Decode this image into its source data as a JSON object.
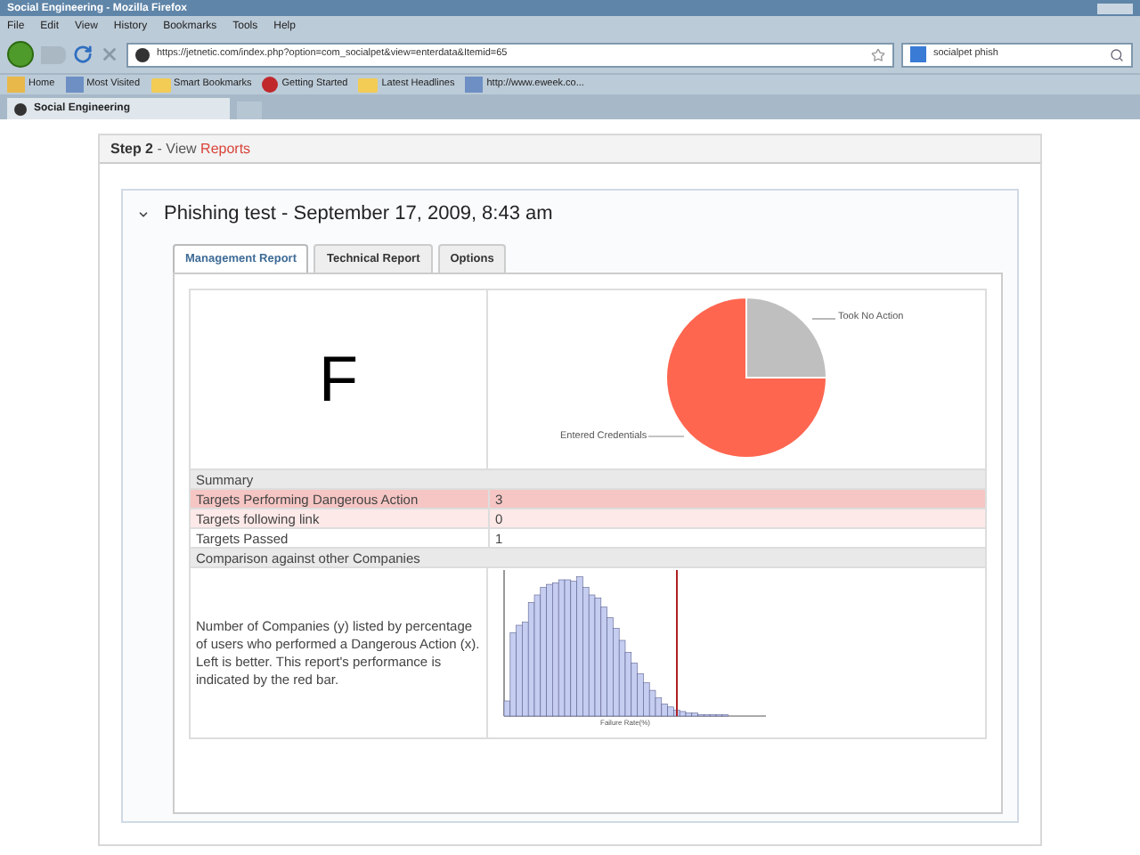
{
  "window": {
    "title": "Social Engineering - Mozilla Firefox"
  },
  "menu": [
    "File",
    "Edit",
    "View",
    "History",
    "Bookmarks",
    "Tools",
    "Help"
  ],
  "address": {
    "value": "https://jetnetic.com/index.php?option=com_socialpet&view=enterdata&Itemid=65"
  },
  "search": {
    "value": "socialpet phish"
  },
  "bookmarks": [
    {
      "label": "Home",
      "kind": "home"
    },
    {
      "label": "Most Visited",
      "kind": "page"
    },
    {
      "label": "Smart Bookmarks",
      "kind": "folder"
    },
    {
      "label": "Getting Started",
      "kind": "start"
    },
    {
      "label": "Latest Headlines",
      "kind": "folder"
    },
    {
      "label": "http://www.eweek.co...",
      "kind": "page"
    }
  ],
  "browser_tabs": [
    {
      "label": "Social Engineering",
      "selected": true
    }
  ],
  "step": {
    "label": "Step 2",
    "separator": " - View ",
    "highlight": "Reports"
  },
  "report": {
    "title": "Phishing test - September 17, 2009, 8:43 am",
    "expanded": true,
    "tabs": [
      {
        "label": "Management Report",
        "selected": true
      },
      {
        "label": "Technical Report",
        "selected": false
      },
      {
        "label": "Options",
        "selected": false
      }
    ],
    "grade": "F",
    "chart_data": {
      "type": "pie",
      "categories": [
        "Entered Credentials",
        "Took No Action"
      ],
      "values": [
        75,
        25
      ],
      "colors": [
        "#ff6650",
        "#bfbfbf"
      ]
    },
    "rows": [
      {
        "kind": "header",
        "label": "Summary"
      },
      {
        "kind": "danger",
        "label": "Targets Performing Dangerous Action",
        "value": "3"
      },
      {
        "kind": "warning",
        "label": "Targets following link",
        "value": "0"
      },
      {
        "kind": "plain",
        "label": "Targets Passed",
        "value": "1"
      },
      {
        "kind": "header",
        "label": "Comparison against other Companies"
      }
    ],
    "comparison": {
      "text": "Number of Companies (y) listed by percentage of users who performed a Dangerous Action (x). Left is better. This report's performance is indicated by the red bar.",
      "axis_label": "Failure Rate(%)"
    }
  }
}
